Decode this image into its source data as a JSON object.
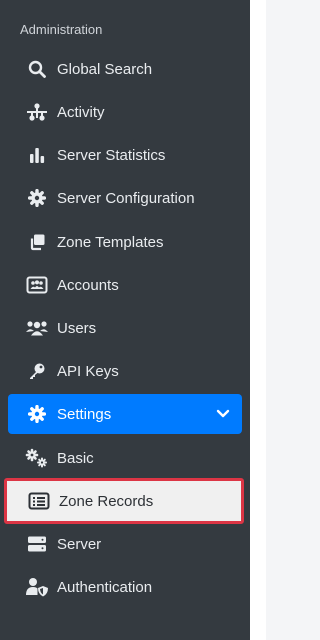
{
  "sidebar": {
    "section_title": "Administration",
    "items": [
      {
        "label": "Global Search",
        "icon": "search-icon"
      },
      {
        "label": "Activity",
        "icon": "activity-icon"
      },
      {
        "label": "Server Statistics",
        "icon": "bar-chart-icon"
      },
      {
        "label": "Server Configuration",
        "icon": "gear-icon"
      },
      {
        "label": "Zone Templates",
        "icon": "copy-icon"
      },
      {
        "label": "Accounts",
        "icon": "address-card-icon"
      },
      {
        "label": "Users",
        "icon": "users-icon"
      },
      {
        "label": "API Keys",
        "icon": "key-icon"
      },
      {
        "label": "Settings",
        "icon": "gear-icon",
        "expanded": true
      },
      {
        "label": "Basic",
        "icon": "gears-icon"
      },
      {
        "label": "Zone Records",
        "icon": "list-icon",
        "selected": true
      },
      {
        "label": "Server",
        "icon": "server-icon"
      },
      {
        "label": "Authentication",
        "icon": "user-shield-icon"
      }
    ]
  },
  "colors": {
    "sidebar_bg": "#343a40",
    "active_parent": "#007bff",
    "selection_outline": "#dc3545"
  }
}
